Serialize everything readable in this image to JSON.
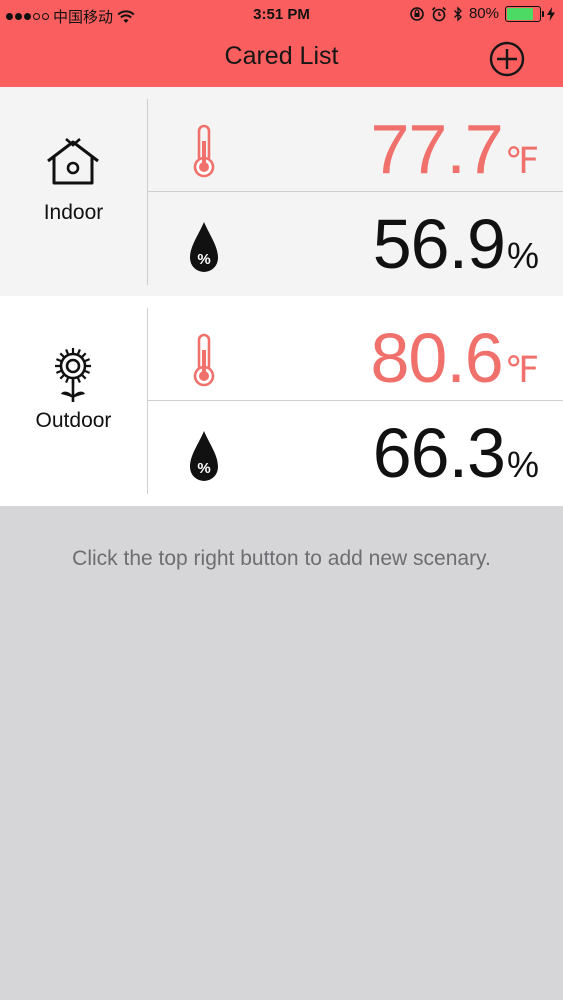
{
  "status_bar": {
    "carrier": "中国移动",
    "time": "3:51 PM",
    "battery": "80%",
    "battery_level": 0.8
  },
  "nav": {
    "title": "Cared List",
    "add_icon": "plus-circle-icon"
  },
  "cards": [
    {
      "label": "Indoor",
      "icon": "house-icon",
      "temperature": "77.7",
      "temperature_unit": "℉",
      "humidity": "56.9",
      "humidity_unit": "%"
    },
    {
      "label": "Outdoor",
      "icon": "sunflower-icon",
      "temperature": "80.6",
      "temperature_unit": "℉",
      "humidity": "66.3",
      "humidity_unit": "%"
    }
  ],
  "empty_hint": "Click the top right button to add new scenary.",
  "colors": {
    "header": "#fb5e5e",
    "temperature": "#f0706c",
    "background": "#d6d5d8"
  }
}
